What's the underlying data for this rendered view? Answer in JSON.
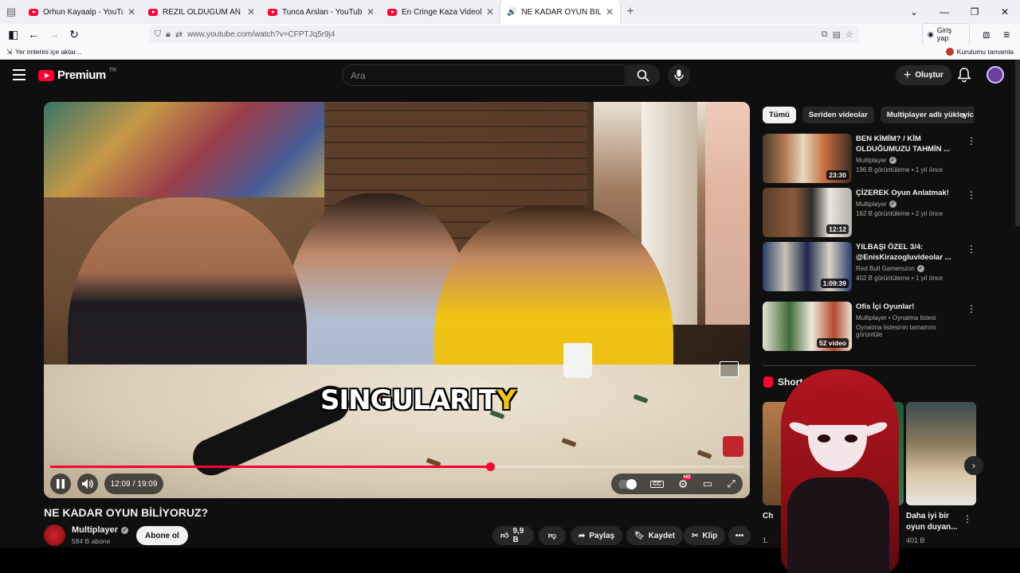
{
  "browser": {
    "tabs": [
      {
        "title": "Orhun Kayaalp - YouTube",
        "active": false
      },
      {
        "title": "REZİL OLDUĞUM AN / CNN M...",
        "active": false
      },
      {
        "title": "Tunca Arslan - YouTube",
        "active": false
      },
      {
        "title": "En Cringe Kaza Videoları! @csni",
        "active": false
      },
      {
        "title": "NE KADAR OYUN BİLİYORU",
        "active": true
      }
    ],
    "url": "www.youtube.com/watch?v=CFPTJq5r9j4",
    "signin_label": "Giriş yap",
    "bookmarks_import": "Yer imlerini içe aktar...",
    "bookmarks_right": "Kurulumu tamamla"
  },
  "masthead": {
    "logo_text": "Premium",
    "logo_country": "TR",
    "search_placeholder": "Ara",
    "create_label": "Oluştur"
  },
  "player": {
    "subtitle_main": "SINGULARIT",
    "subtitle_highlight": "Y",
    "current_time": "12:09",
    "separator": "/",
    "duration": "19:09",
    "progress": 0.634
  },
  "video": {
    "title": "NE KADAR OYUN BİLİYORUZ?",
    "channel": "Multiplayer",
    "subscribers": "584 B abone",
    "subscribe_label": "Abone ol",
    "likes": "9,9 B",
    "share_label": "Paylaş",
    "save_label": "Kaydet",
    "clip_label": "Klip"
  },
  "sidebar": {
    "chips": [
      "Tümü",
      "Seriden videolar",
      "Multiplayer adlı yükleyiciden"
    ],
    "recommendations": [
      {
        "title": "BEN KİMİM? / KİM OLDUĞUMUZU TAHMİN ...",
        "channel": "Multiplayer",
        "meta": "196 B görüntüleme • 1 yıl önce",
        "duration": "23:30"
      },
      {
        "title": "ÇİZEREK Oyun Anlatmak!",
        "channel": "Multiplayer",
        "meta": "162 B görüntüleme • 2 yıl önce",
        "duration": "12:12"
      },
      {
        "title": "YILBAŞI ÖZEL 3/4: @EnisKirazogluvideolar ...",
        "channel": "Red Bull Gamerszon",
        "meta": "402 B görüntüleme • 1 yıl önce",
        "duration": "1:09:39"
      },
      {
        "title": "Ofis İçi Oyunlar!",
        "channel": "Multiplayer • Oynatma listesi",
        "meta": "Oynatma listesinin tamamını görüntüle",
        "duration": "52 video"
      }
    ],
    "shorts_header": "Shorts",
    "shorts": [
      {
        "title": "Ch... v...",
        "views": "1..."
      },
      {
        "title": "",
        "views": ""
      },
      {
        "title": "Daha iyi bir oyun duyan...",
        "views": "401 B"
      }
    ]
  },
  "colors": {
    "yt_red": "#ff0033",
    "subtitle_highlight": "#f2c60f",
    "background": "#0f0f0f"
  }
}
